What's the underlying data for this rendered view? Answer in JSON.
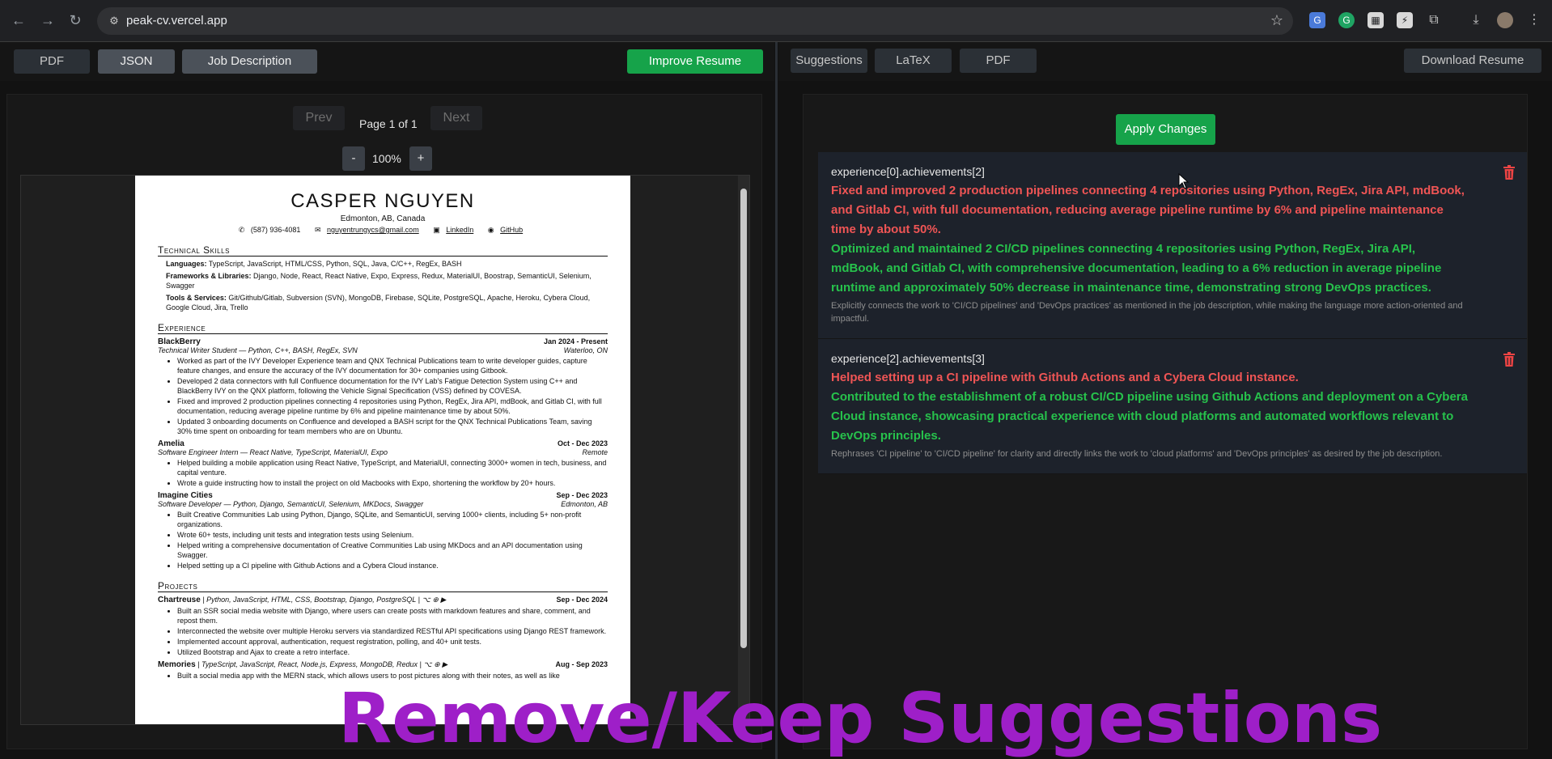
{
  "browser": {
    "url": "peak-cv.vercel.app"
  },
  "left_toolbar": {
    "tab_pdf": "PDF",
    "tab_json": "JSON",
    "tab_job": "Job Description",
    "improve": "Improve Resume"
  },
  "right_toolbar": {
    "tab_suggestions": "Suggestions",
    "tab_latex": "LaTeX",
    "tab_pdf": "PDF",
    "download": "Download Resume"
  },
  "pager": {
    "prev": "Prev",
    "page": "Page 1 of 1",
    "next": "Next",
    "minus": "-",
    "zoom": "100%",
    "plus": "+"
  },
  "resume": {
    "name": "CASPER NGUYEN",
    "location": "Edmonton, AB, Canada",
    "phone": "(587) 936-4081",
    "email": "nguyentrungycs@gmail.com",
    "linkedin": "LinkedIn",
    "github": "GitHub",
    "skills_title": "Technical Skills",
    "skills": [
      {
        "k": "Languages:",
        "v": " TypeScript, JavaScript, HTML/CSS, Python, SQL, Java, C/C++, RegEx, BASH"
      },
      {
        "k": "Frameworks & Libraries:",
        "v": " Django, Node, React, React Native, Expo, Express, Redux, MaterialUI, Boostrap, SemanticUI, Selenium, Swagger"
      },
      {
        "k": "Tools & Services:",
        "v": " Git/Github/Gitlab, Subversion (SVN), MongoDB, Firebase, SQLite, PostgreSQL, Apache, Heroku, Cybera Cloud, Google Cloud, Jira, Trello"
      }
    ],
    "exp_title": "Experience",
    "jobs": [
      {
        "company": "BlackBerry",
        "date": "Jan 2024 - Present",
        "role": "Technical Writer Student — Python, C++, BASH, RegEx, SVN",
        "place": "Waterloo, ON",
        "bullets": [
          "Worked as part of the IVY Developer Experience team and QNX Technical Publications team to write developer guides, capture feature changes, and ensure the accuracy of the IVY documentation for 30+ companies using Gitbook.",
          "Developed 2 data connectors with full Confluence documentation for the IVY Lab's Fatigue Detection System using C++ and BlackBerry IVY on the QNX platform, following the Vehicle Signal Specification (VSS) defined by COVESA.",
          "Fixed and improved 2 production pipelines connecting 4 repositories using Python, RegEx, Jira API, mdBook, and Gitlab CI, with full documentation, reducing average pipeline runtime by 6% and pipeline maintenance time by about 50%.",
          "Updated 3 onboarding documents on Confluence and developed a BASH script for the QNX Technical Publications Team, saving 30% time spent on onboarding for team members who are on Ubuntu."
        ]
      },
      {
        "company": "Amelia",
        "date": "Oct - Dec 2023",
        "role": "Software Engineer Intern — React Native, TypeScript, MaterialUI, Expo",
        "place": "Remote",
        "bullets": [
          "Helped building a mobile application using React Native, TypeScript, and MaterialUI, connecting 3000+ women in tech, business, and capital venture.",
          "Wrote a guide instructing how to install the project on old Macbooks with Expo, shortening the workflow by 20+ hours."
        ]
      },
      {
        "company": "Imagine Cities",
        "date": "Sep - Dec 2023",
        "role": "Software Developer — Python, Django, SemanticUI, Selenium, MKDocs, Swagger",
        "place": "Edmonton, AB",
        "bullets": [
          "Built Creative Communities Lab using Python, Django, SQLite, and SemanticUI, serving 1000+ clients, including 5+ non-profit organizations.",
          "Wrote 60+ tests, including unit tests and integration tests using Selenium.",
          "Helped writing a comprehensive documentation of Creative Communities Lab using MKDocs and an API documentation using Swagger.",
          "Helped setting up a CI pipeline with Github Actions and a Cybera Cloud instance."
        ]
      }
    ],
    "proj_title": "Projects",
    "projects": [
      {
        "name": "Chartreuse",
        "stack": " | Python, JavaScript, HTML, CSS, Bootstrap, Django, PostgreSQL | ⌥ ⊕ ▶",
        "date": "Sep - Dec 2024",
        "bullets": [
          "Built an SSR social media website with Django, where users can create posts with markdown features and share, comment, and repost them.",
          "Interconnected the website over multiple Heroku servers via standardized RESTful API specifications using Django REST framework.",
          "Implemented account approval, authentication, request registration, polling, and 40+ unit tests.",
          "Utilized Bootstrap and Ajax to create a retro interface."
        ]
      },
      {
        "name": "Memories",
        "stack": " | TypeScript, JavaScript, React, Node.js, Express, MongoDB, Redux | ⌥ ⊕ ▶",
        "date": "Aug - Sep 2023",
        "bullets": [
          "Built a social media app with the MERN stack, which allows users to post pictures along with their notes, as well as like"
        ]
      }
    ]
  },
  "suggestions": {
    "apply": "Apply Changes",
    "items": [
      {
        "path": "experience[0].achievements[2]",
        "old": "Fixed and improved 2 production pipelines connecting 4 repositories using Python, RegEx, Jira API, mdBook, and Gitlab CI, with full documentation, reducing average pipeline runtime by 6% and pipeline maintenance time by about 50%.",
        "new": "Optimized and maintained 2 CI/CD pipelines connecting 4 repositories using Python, RegEx, Jira API, mdBook, and Gitlab CI, with comprehensive documentation, leading to a 6% reduction in average pipeline runtime and approximately 50% decrease in maintenance time, demonstrating strong DevOps practices.",
        "why": "Explicitly connects the work to 'CI/CD pipelines' and 'DevOps practices' as mentioned in the job description, while making the language more action-oriented and impactful."
      },
      {
        "path": "experience[2].achievements[3]",
        "old": "Helped setting up a CI pipeline with Github Actions and a Cybera Cloud instance.",
        "new": "Contributed to the establishment of a robust CI/CD pipeline using Github Actions and deployment on a Cybera Cloud instance, showcasing practical experience with cloud platforms and automated workflows relevant to DevOps principles.",
        "why": "Rephrases 'CI pipeline' to 'CI/CD pipeline' for clarity and directly links the work to 'cloud platforms' and 'DevOps principles' as desired by the job description."
      }
    ]
  },
  "overlay_caption": "Remove/Keep Suggestions",
  "colors": {
    "green": "#16a34a",
    "old": "#ef5555",
    "new": "#27c24c",
    "caption": "#9e1fc8"
  }
}
